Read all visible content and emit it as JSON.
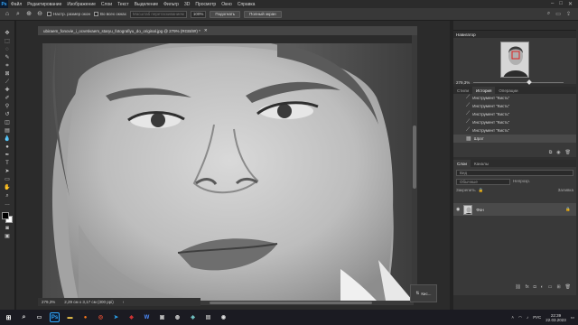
{
  "menu": {
    "logo": "Ps",
    "items": [
      "Файл",
      "Редактирование",
      "Изображение",
      "Слои",
      "Текст",
      "Выделение",
      "Фильтр",
      "3D",
      "Просмотр",
      "Окно",
      "Справка"
    ]
  },
  "options": {
    "resize_windows_label": "Настр. размер окон",
    "all_windows_label": "Во всех окнах",
    "scrubby_zoom_value": "Масштаб перетаскиванием",
    "zoom_value": "100%",
    "fit_button": "Подогнать",
    "fill_screen_button": "Полный экран"
  },
  "document": {
    "tab_title": "ubiraem_fonovie_i_ocvetivaem_staryu_fotografiyu_do_original.jpg @ 279% (RGB/8#) *",
    "status_zoom": "279,3%",
    "status_size": "2,29 см x 3,17 см (300 ppi)",
    "float_label": "Кис..."
  },
  "navigator": {
    "title": "Навигатор",
    "zoom": "279,3%"
  },
  "history": {
    "tabs": [
      "Стили",
      "История",
      "Операции"
    ],
    "items": [
      "Инструмент \"Кисть\"",
      "Инструмент \"Кисть\"",
      "Инструмент \"Кисть\"",
      "Инструмент \"Кисть\"",
      "Инструмент \"Кисть\""
    ],
    "last_item": "Шрат"
  },
  "layers": {
    "tabs": [
      "Слои",
      "Каналы"
    ],
    "search_placeholder": "Вид",
    "blend_mode": "Обычные",
    "opacity_label": "Непрозр.",
    "lock_label": "Закрепить",
    "fill_label": "Заливка",
    "layer_name": "Фон"
  },
  "taskbar": {
    "lang": "РУС",
    "time": "22:39",
    "date": "22.03.2023"
  },
  "colors": {
    "accent": "#31a8ff",
    "fg": "#000000",
    "bg": "#ffffff"
  }
}
